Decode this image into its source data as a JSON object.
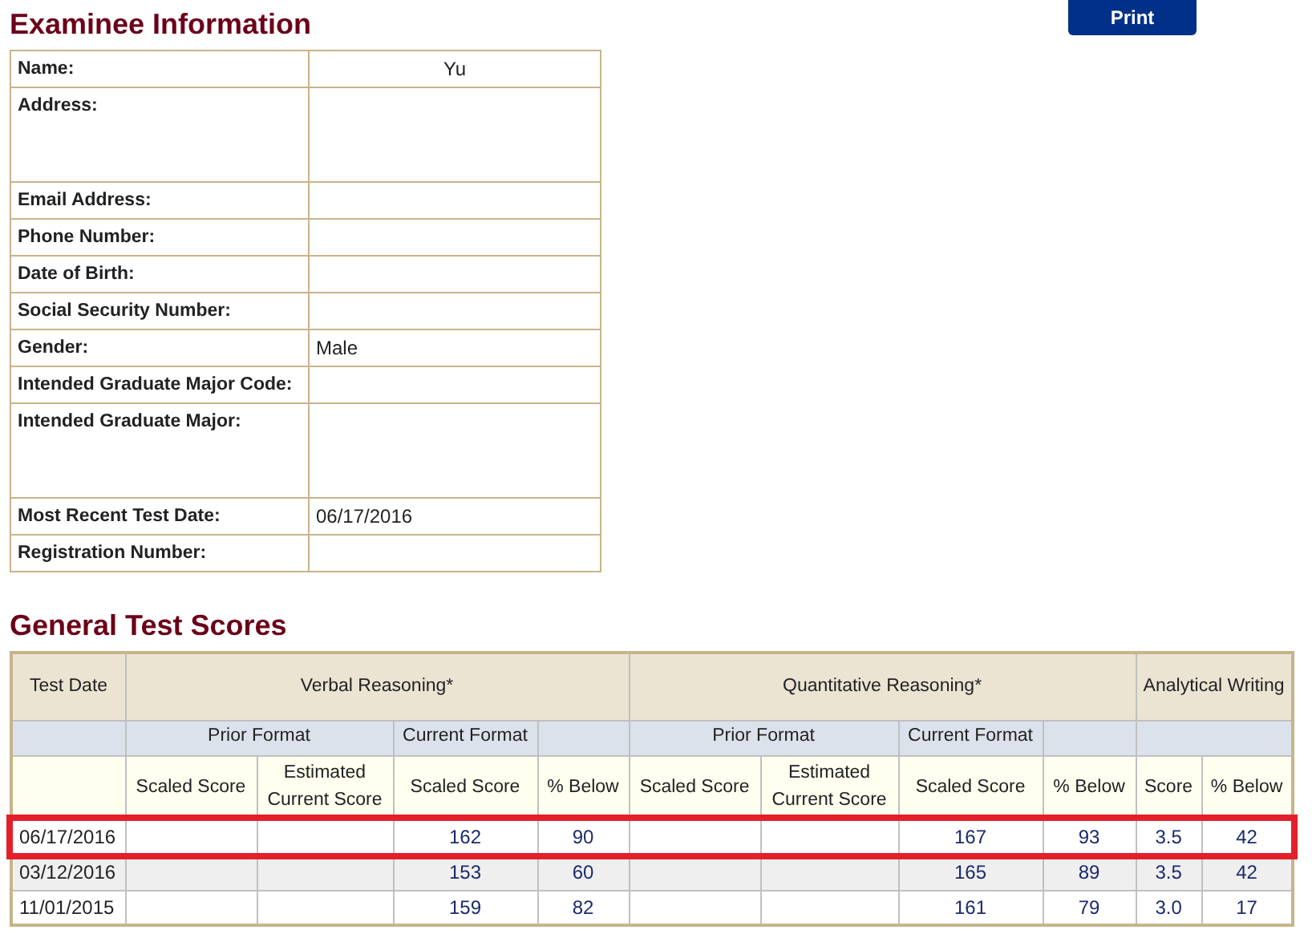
{
  "examinee": {
    "title": "Examinee Information",
    "fields": [
      {
        "label": "Name:",
        "value": "Yu",
        "tall": false
      },
      {
        "label": "Address:",
        "tall": true
      },
      {
        "label": "Email Address:",
        "tall": false
      },
      {
        "label": "Phone Number:",
        "tall": false
      },
      {
        "label": "Date of Birth:",
        "tall": false
      },
      {
        "label": "Social Security Number:",
        "tall": false
      },
      {
        "label": "Gender:",
        "value": "Male",
        "tall": false
      },
      {
        "label": "Intended Graduate Major Code:",
        "tall": false
      },
      {
        "label": "Intended Graduate Major:",
        "tall": true
      },
      {
        "label": "Most Recent Test Date:",
        "value": "06/17/2016",
        "tall": false
      },
      {
        "label": "Registration Number:",
        "tall": false
      }
    ]
  },
  "print_button": "Print",
  "scores": {
    "title": "General Test Scores",
    "header_1": [
      "Test Date",
      "Verbal Reasoning*",
      "Quantitative Reasoning*",
      "Analytical Writing"
    ],
    "header_2": [
      "Prior Format",
      "Current Format",
      "Prior Format",
      "Current Format"
    ],
    "header_3": [
      "Scaled Score",
      "Estimated Current Score",
      "Scaled Score",
      "% Below",
      "Scaled Score",
      "Estimated Current Score",
      "Scaled Score",
      "% Below",
      "Score",
      "% Below"
    ],
    "rows": [
      {
        "highlighted": true,
        "date": "06/17/2016",
        "verbal_scaled": "162",
        "verbal_below": "90",
        "quant_scaled": "167",
        "quant_below": "93",
        "writing_score": "3.5",
        "writing_below": "42"
      },
      {
        "highlighted": false,
        "date": "03/12/2016",
        "verbal_scaled": "153",
        "verbal_below": "60",
        "quant_scaled": "165",
        "quant_below": "89",
        "writing_score": "3.5",
        "writing_below": "42"
      },
      {
        "highlighted": false,
        "date": "11/01/2015",
        "verbal_scaled": "159",
        "verbal_below": "82",
        "quant_scaled": "161",
        "quant_below": "79",
        "writing_score": "3.0",
        "writing_below": "17"
      }
    ]
  }
}
